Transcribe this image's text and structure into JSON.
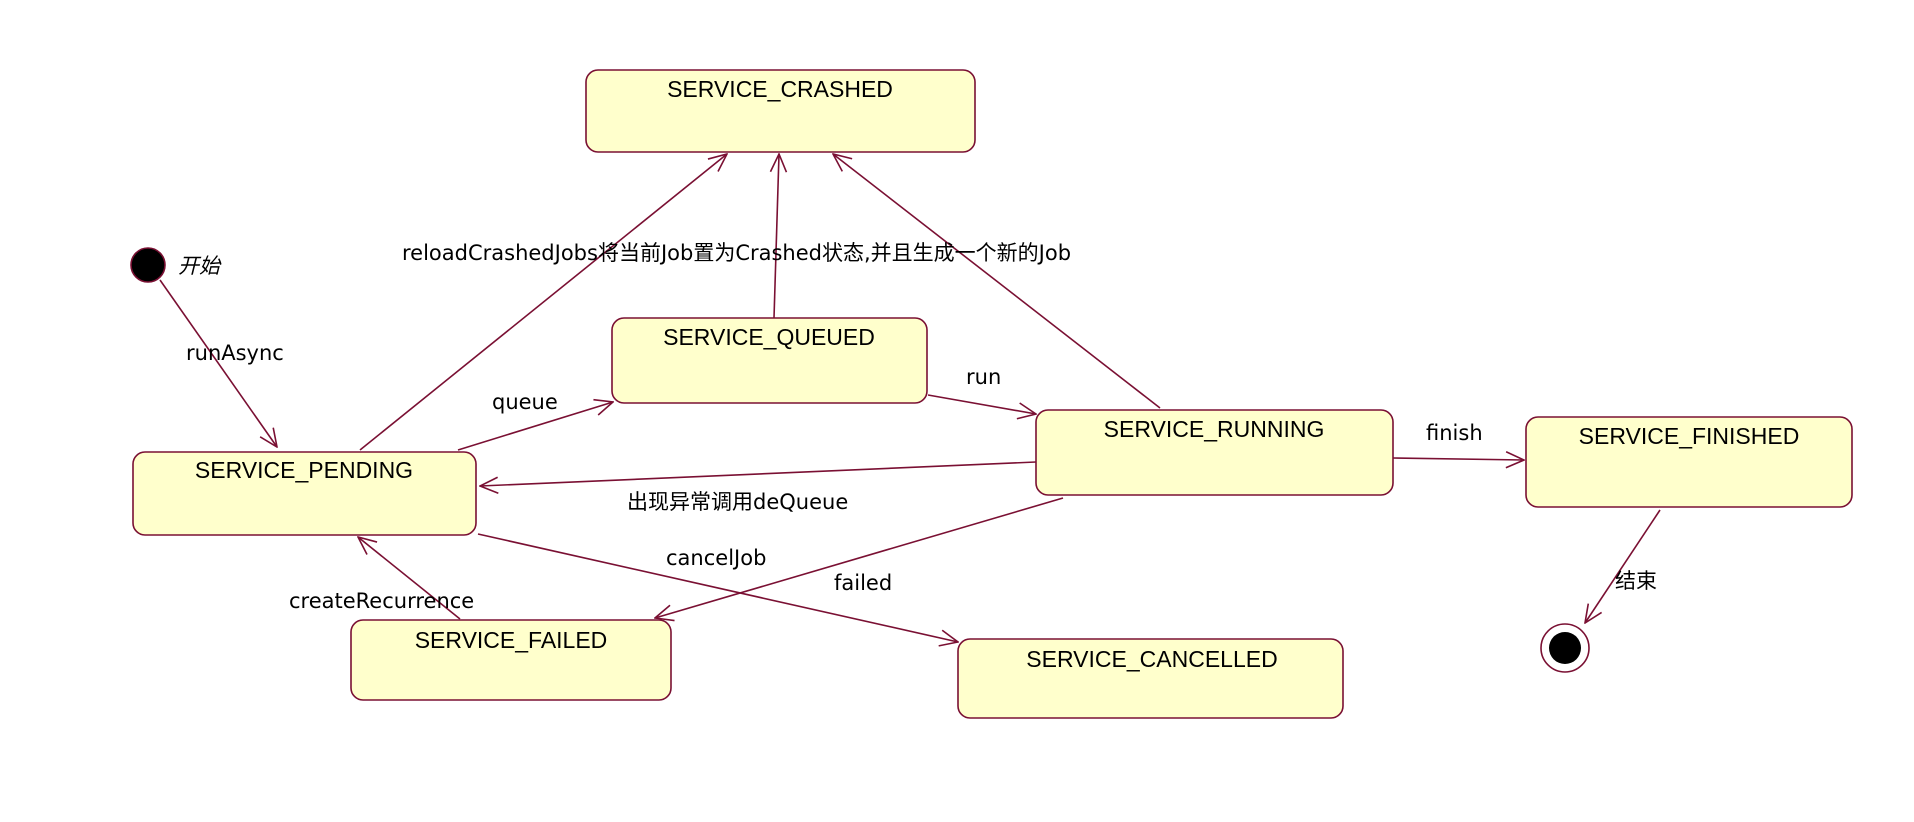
{
  "diagram": {
    "states": {
      "crashed": "SERVICE_CRASHED",
      "queued": "SERVICE_QUEUED",
      "pending": "SERVICE_PENDING",
      "running": "SERVICE_RUNNING",
      "finished": "SERVICE_FINISHED",
      "failed": "SERVICE_FAILED",
      "cancelled": "SERVICE_CANCELLED"
    },
    "pseudo": {
      "start_label": "开始",
      "end_label": "结束"
    },
    "transitions": {
      "run_async": "runAsync",
      "queue": "queue",
      "run": "run",
      "finish": "finish",
      "dequeue": "出现异常调用deQueue",
      "cancel_job": "cancelJob",
      "failed": "failed",
      "create_recurrence": "createRecurrence",
      "reload_crashed": "reloadCrashedJobs将当前Job置为Crashed状态,并且生成一个新的Job"
    },
    "colors": {
      "state_fill": "#ffffcc",
      "line": "#7a1033"
    }
  }
}
